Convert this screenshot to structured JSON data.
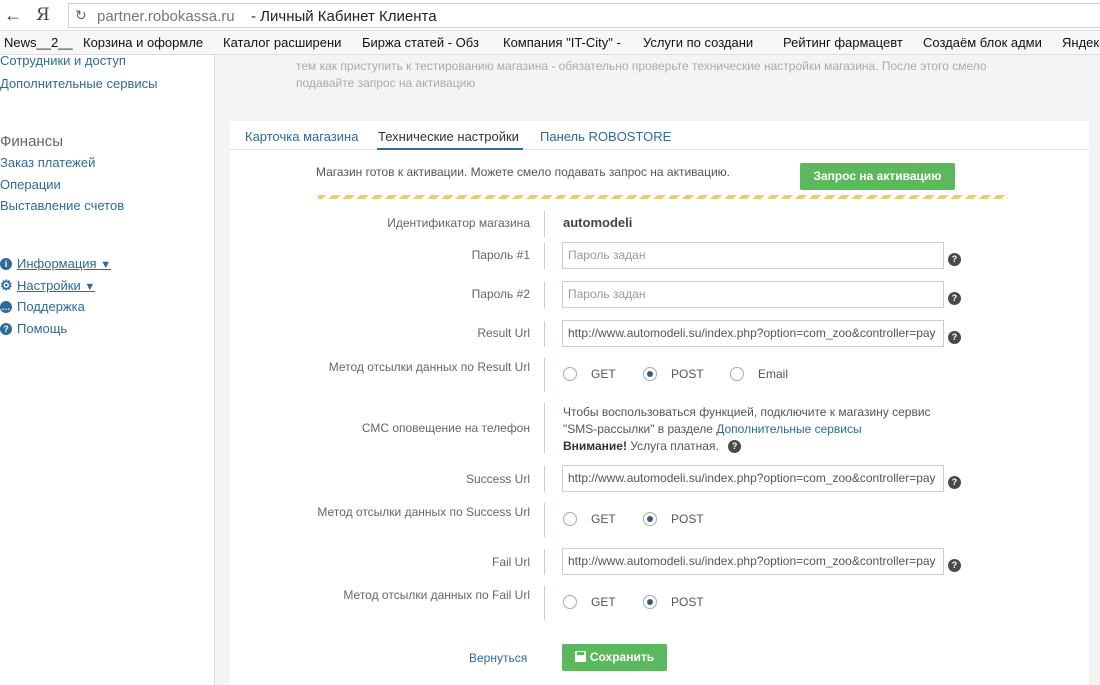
{
  "browser": {
    "url_host": "partner.robokassa.ru",
    "page_title": "- Личный Кабинет Клиента",
    "yandex_label": "Я",
    "bookmarks": [
      "News__2__",
      "Корзина и оформле",
      "Каталог расширени",
      "Биржа статей - Обз",
      "Компания \"IT-City\" -",
      "Услуги по создани",
      "Рейтинг фармацевт",
      "Создаём блок адми",
      "Яндекс"
    ]
  },
  "sidebar": {
    "links_top": [
      "Сотрудники и доступ",
      "Дополнительные сервисы"
    ],
    "finance_heading": "Финансы",
    "finance_links": [
      "Заказ платежей",
      "Операции",
      "Выставление счетов"
    ],
    "info_items": [
      {
        "label": "Информация",
        "icon": "info-icon",
        "arrow": "▼"
      },
      {
        "label": "Настройки",
        "icon": "gear-icon",
        "arrow": "▼"
      },
      {
        "label": "Поддержка",
        "icon": "chat-icon"
      },
      {
        "label": "Помощь",
        "icon": "question-icon"
      }
    ]
  },
  "intro_text": "тем как приступить к тестированию магазина - обязательно проверьте технические настройки магазина. После этого смело подавайте запрос на активацию",
  "tabs": [
    "Карточка магазина",
    "Технические настройки",
    "Панель ROBOSTORE"
  ],
  "activation": {
    "ready_text": "Магазин готов к активации. Можете смело подавать запрос на активацию.",
    "button": "Запрос на активацию"
  },
  "form": {
    "shop_id_label": "Идентификатор магазина",
    "shop_id_value": "automodeli",
    "password1_label": "Пароль #1",
    "password1_placeholder": "Пароль задан",
    "password2_label": "Пароль #2",
    "password2_placeholder": "Пароль задан",
    "result_url_label": "Result Url",
    "result_url_value": "http://www.automodeli.su/index.php?option=com_zoo&controller=pay",
    "result_method_label": "Метод отсылки данных по Result Url",
    "result_methods": [
      "GET",
      "POST",
      "Email"
    ],
    "result_selected": "POST",
    "sms_label": "СМС оповещение на телефон",
    "sms_text_1": "Чтобы воспользоваться функцией, подключите к магазину сервис \"SMS-рассылки\" в разделе",
    "sms_link": "Дополнительные сервисы",
    "sms_attention": "Внимание!",
    "sms_paid": "Услуга платная.",
    "success_url_label": "Success Url",
    "success_url_value": "http://www.automodeli.su/index.php?option=com_zoo&controller=pay",
    "success_method_label": "Метод отсылки данных по Success Url",
    "success_methods": [
      "GET",
      "POST"
    ],
    "success_selected": "POST",
    "fail_url_label": "Fail Url",
    "fail_url_value": "http://www.automodeli.su/index.php?option=com_zoo&controller=pay",
    "fail_method_label": "Метод отсылки данных по Fail Url",
    "fail_methods": [
      "GET",
      "POST"
    ],
    "fail_selected": "POST",
    "back_label": "Вернуться",
    "save_label": "Сохранить"
  },
  "colors": {
    "accent": "#2f6a99",
    "button_green": "#5cb85c",
    "dash_stripe": "#f0c87a"
  }
}
